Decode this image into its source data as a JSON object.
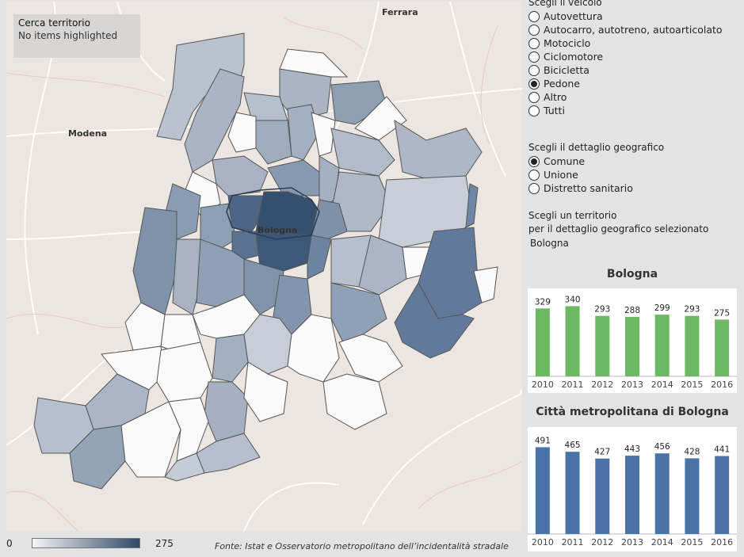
{
  "map": {
    "search_title": "Cerca territorio",
    "search_status": "No items highlighted",
    "city_labels": {
      "ferrara": "Ferrara",
      "modena": "Modena",
      "bologna": "Bologna"
    },
    "legend": {
      "min": "0",
      "max": "275",
      "color_low": "#f4f5f7",
      "color_high": "#2f4966"
    },
    "source": "Fonte: Istat e Osservatorio metropolitano dell’incidentalità stradale"
  },
  "vehicle": {
    "title": "Scegli il veicolo",
    "options": [
      "Autovettura",
      "Autocarro, autotreno, autoarticolato",
      "Motociclo",
      "Ciclomotore",
      "Bicicletta",
      "Pedone",
      "Altro",
      "Tutti"
    ],
    "selected": "Pedone"
  },
  "geo": {
    "title": "Scegli il dettaglio geografico",
    "options": [
      "Comune",
      "Unione",
      "Distretto sanitario"
    ],
    "selected": "Comune"
  },
  "territory": {
    "title_line1": "Scegli un territorio",
    "title_line2": "per il dettaglio geografico selezionato",
    "value": "Bologna"
  },
  "chart_data": [
    {
      "type": "bar",
      "title": "Bologna",
      "categories": [
        "2010",
        "2011",
        "2012",
        "2013",
        "2014",
        "2015",
        "2016"
      ],
      "values": [
        329,
        340,
        293,
        288,
        299,
        293,
        275
      ],
      "color": "#6db862",
      "ylim": [
        0,
        380
      ]
    },
    {
      "type": "bar",
      "title": "Città metropolitana di Bologna",
      "categories": [
        "2010",
        "2011",
        "2012",
        "2013",
        "2014",
        "2015",
        "2016"
      ],
      "values": [
        491,
        465,
        427,
        443,
        456,
        428,
        441
      ],
      "color": "#4a73a6",
      "ylim": [
        0,
        560
      ]
    }
  ]
}
